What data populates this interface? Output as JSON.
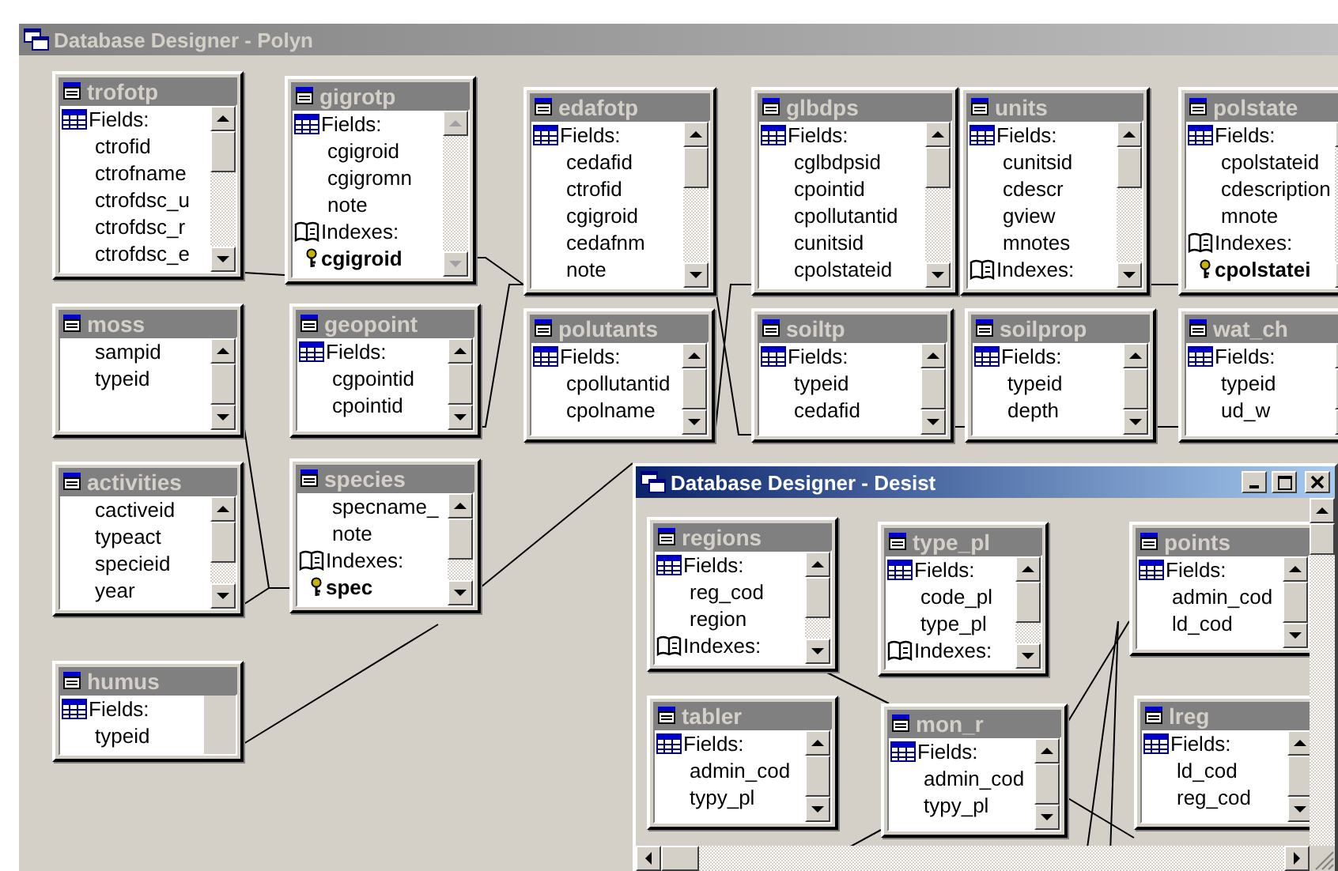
{
  "main_window": {
    "title": "Database Designer - Polyn",
    "active": false,
    "tables": [
      {
        "name": "trofotp",
        "scrollbar": true,
        "disabled": false,
        "rows": [
          {
            "kind": "fields_heading",
            "text": "Fields:"
          },
          {
            "kind": "field",
            "text": "ctrofid"
          },
          {
            "kind": "field",
            "text": "ctrofname"
          },
          {
            "kind": "field",
            "text": "ctrofdsc_u"
          },
          {
            "kind": "field",
            "text": "ctrofdsc_r"
          },
          {
            "kind": "field",
            "text": "ctrofdsc_e"
          }
        ]
      },
      {
        "name": "gigrotp",
        "scrollbar": true,
        "disabled": true,
        "rows": [
          {
            "kind": "fields_heading",
            "text": "Fields:"
          },
          {
            "kind": "field",
            "text": "cgigroid"
          },
          {
            "kind": "field",
            "text": "cgigromn"
          },
          {
            "kind": "field",
            "text": "note"
          },
          {
            "kind": "indexes_heading",
            "text": "Indexes:"
          },
          {
            "kind": "index",
            "text": "cgigroid"
          }
        ]
      },
      {
        "name": "edafotp",
        "scrollbar": true,
        "disabled": false,
        "rows": [
          {
            "kind": "fields_heading",
            "text": "Fields:"
          },
          {
            "kind": "field",
            "text": "cedafid"
          },
          {
            "kind": "field",
            "text": "ctrofid"
          },
          {
            "kind": "field",
            "text": "cgigroid"
          },
          {
            "kind": "field",
            "text": "cedafnm"
          },
          {
            "kind": "field",
            "text": "note"
          }
        ]
      },
      {
        "name": "glbdps",
        "scrollbar": true,
        "disabled": false,
        "rows": [
          {
            "kind": "fields_heading",
            "text": "Fields:"
          },
          {
            "kind": "field",
            "text": "cglbdpsid"
          },
          {
            "kind": "field",
            "text": "cpointid"
          },
          {
            "kind": "field",
            "text": "cpollutantid"
          },
          {
            "kind": "field",
            "text": "cunitsid"
          },
          {
            "kind": "field",
            "text": "cpolstateid"
          }
        ]
      },
      {
        "name": "units",
        "scrollbar": true,
        "disabled": false,
        "rows": [
          {
            "kind": "fields_heading",
            "text": "Fields:"
          },
          {
            "kind": "field",
            "text": "cunitsid"
          },
          {
            "kind": "field",
            "text": "cdescr"
          },
          {
            "kind": "field",
            "text": "gview"
          },
          {
            "kind": "field",
            "text": "mnotes"
          },
          {
            "kind": "indexes_heading",
            "text": "Indexes:"
          }
        ]
      },
      {
        "name": "polstate",
        "scrollbar": true,
        "disabled": true,
        "rows": [
          {
            "kind": "fields_heading",
            "text": "Fields:"
          },
          {
            "kind": "field",
            "text": "cpolstateid"
          },
          {
            "kind": "field",
            "text": "cdescription"
          },
          {
            "kind": "field",
            "text": "mnote"
          },
          {
            "kind": "indexes_heading",
            "text": "Indexes:"
          },
          {
            "kind": "index",
            "text": "cpolstatei"
          }
        ]
      },
      {
        "name": "moss",
        "scrollbar": true,
        "disabled": false,
        "rows": [
          {
            "kind": "field",
            "text": "sampid"
          },
          {
            "kind": "field",
            "text": "typeid"
          }
        ]
      },
      {
        "name": "geopoint",
        "scrollbar": true,
        "disabled": false,
        "rows": [
          {
            "kind": "fields_heading",
            "text": "Fields:"
          },
          {
            "kind": "field",
            "text": "cgpointid"
          },
          {
            "kind": "field",
            "text": "cpointid"
          }
        ]
      },
      {
        "name": "polutants",
        "scrollbar": true,
        "disabled": false,
        "rows": [
          {
            "kind": "fields_heading",
            "text": "Fields:"
          },
          {
            "kind": "field",
            "text": "cpollutantid"
          },
          {
            "kind": "field",
            "text": "cpolname"
          }
        ]
      },
      {
        "name": "soiltp",
        "scrollbar": true,
        "disabled": false,
        "rows": [
          {
            "kind": "fields_heading",
            "text": "Fields:"
          },
          {
            "kind": "field",
            "text": "typeid"
          },
          {
            "kind": "field",
            "text": "cedafid"
          }
        ]
      },
      {
        "name": "soilprop",
        "scrollbar": true,
        "disabled": false,
        "rows": [
          {
            "kind": "fields_heading",
            "text": "Fields:"
          },
          {
            "kind": "field",
            "text": "typeid"
          },
          {
            "kind": "field",
            "text": "depth"
          }
        ]
      },
      {
        "name": "wat_ch",
        "scrollbar": true,
        "disabled": false,
        "rows": [
          {
            "kind": "fields_heading",
            "text": "Fields:"
          },
          {
            "kind": "field",
            "text": "typeid"
          },
          {
            "kind": "field",
            "text": "ud_w"
          }
        ]
      },
      {
        "name": "activities",
        "scrollbar": true,
        "disabled": false,
        "rows": [
          {
            "kind": "field",
            "text": "cactiveid"
          },
          {
            "kind": "field",
            "text": "typeact"
          },
          {
            "kind": "field",
            "text": "specieid"
          },
          {
            "kind": "field",
            "text": "year"
          }
        ]
      },
      {
        "name": "species",
        "scrollbar": true,
        "disabled": false,
        "rows": [
          {
            "kind": "field",
            "text": "specname_"
          },
          {
            "kind": "field",
            "text": "note"
          },
          {
            "kind": "indexes_heading",
            "text": "Indexes:"
          },
          {
            "kind": "index",
            "text": "spec"
          }
        ]
      },
      {
        "name": "humus",
        "scrollbar": false,
        "rows": [
          {
            "kind": "fields_heading",
            "text": "Fields:"
          },
          {
            "kind": "field",
            "text": "typeid"
          }
        ]
      }
    ]
  },
  "child_window": {
    "title": "Database Designer - Desist",
    "active": true,
    "tables": [
      {
        "name": "regions",
        "scrollbar": true,
        "disabled": false,
        "rows": [
          {
            "kind": "fields_heading",
            "text": "Fields:"
          },
          {
            "kind": "field",
            "text": "reg_cod"
          },
          {
            "kind": "field",
            "text": "region"
          },
          {
            "kind": "indexes_heading",
            "text": "Indexes:"
          }
        ]
      },
      {
        "name": "type_pl",
        "scrollbar": true,
        "disabled": false,
        "rows": [
          {
            "kind": "fields_heading",
            "text": "Fields:"
          },
          {
            "kind": "field",
            "text": "code_pl"
          },
          {
            "kind": "field",
            "text": "type_pl"
          },
          {
            "kind": "indexes_heading",
            "text": "Indexes:"
          }
        ]
      },
      {
        "name": "points",
        "scrollbar": true,
        "disabled": false,
        "rows": [
          {
            "kind": "fields_heading",
            "text": "Fields:"
          },
          {
            "kind": "field",
            "text": "admin_cod"
          },
          {
            "kind": "field",
            "text": "ld_cod"
          }
        ]
      },
      {
        "name": "tabler",
        "scrollbar": true,
        "disabled": false,
        "rows": [
          {
            "kind": "fields_heading",
            "text": "Fields:"
          },
          {
            "kind": "field",
            "text": "admin_cod"
          },
          {
            "kind": "field",
            "text": "typy_pl"
          }
        ]
      },
      {
        "name": "mon_r",
        "scrollbar": true,
        "disabled": false,
        "rows": [
          {
            "kind": "fields_heading",
            "text": "Fields:"
          },
          {
            "kind": "field",
            "text": "admin_cod"
          },
          {
            "kind": "field",
            "text": "typy_pl"
          }
        ]
      },
      {
        "name": "lreg",
        "scrollbar": true,
        "disabled": false,
        "rows": [
          {
            "kind": "fields_heading",
            "text": "Fields:"
          },
          {
            "kind": "field",
            "text": "ld_cod"
          },
          {
            "kind": "field",
            "text": "reg_cod"
          }
        ]
      }
    ]
  }
}
